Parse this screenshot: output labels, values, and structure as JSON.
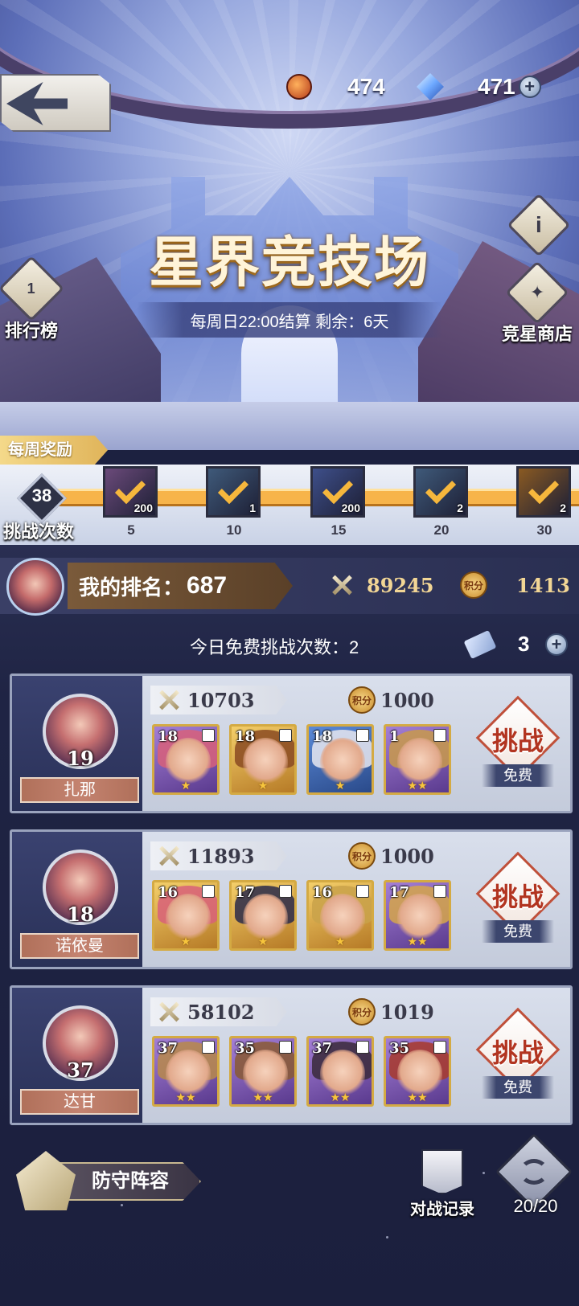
{
  "header": {
    "currency_1": {
      "icon": "scroll-token-icon",
      "value": "474"
    },
    "currency_2": {
      "icon": "blue-crystal-icon",
      "value": "471",
      "plus": "+"
    }
  },
  "arena": {
    "title": "星界竞技场",
    "subtitle": "每周日22:00结算  剩余：6天"
  },
  "side_buttons": {
    "leaderboard": "排行榜",
    "info": "i",
    "shop": "竞星商店"
  },
  "weekly_reward": {
    "tag": "每周奖励",
    "challenge_count": "38",
    "challenge_label": "挑战次数",
    "progress_fraction": 1.0,
    "milestones": [
      {
        "threshold": "5",
        "qty": "200",
        "color": "#6b4a7a"
      },
      {
        "threshold": "10",
        "qty": "1",
        "color": "#3f5a7a"
      },
      {
        "threshold": "15",
        "qty": "200",
        "color": "#3e4f8a"
      },
      {
        "threshold": "20",
        "qty": "2",
        "color": "#3f5a7a"
      },
      {
        "threshold": "30",
        "qty": "2",
        "color": "#8a5a22"
      }
    ]
  },
  "my_rank": {
    "label": "我的排名：",
    "value": "687",
    "power": "89245",
    "score_badge": "积分",
    "score": "1413"
  },
  "free_challenges": {
    "label": "今日免费挑战次数：2",
    "tickets": "3",
    "plus": "+"
  },
  "opponents": [
    {
      "name": "扎那",
      "level": "19",
      "power": "10703",
      "score_badge": "积分",
      "score": "1000",
      "challenge": "挑战",
      "cost": "免费",
      "heroes": [
        {
          "level": "18",
          "frame": "purple",
          "hair": "#d8607a"
        },
        {
          "level": "18",
          "frame": "gold",
          "hair": "#8a4a22"
        },
        {
          "level": "18",
          "frame": "blue",
          "hair": "#e8e8f0"
        },
        {
          "level": "1",
          "frame": "purple",
          "hair": "#c99a4a"
        }
      ]
    },
    {
      "name": "诺依曼",
      "level": "18",
      "power": "11893",
      "score_badge": "积分",
      "score": "1000",
      "challenge": "挑战",
      "cost": "免费",
      "heroes": [
        {
          "level": "16",
          "frame": "gold",
          "hair": "#d8607a"
        },
        {
          "level": "17",
          "frame": "gold",
          "hair": "#2a2a4a"
        },
        {
          "level": "16",
          "frame": "gold",
          "hair": "#c9a24a"
        },
        {
          "level": "17",
          "frame": "purple",
          "hair": "#d6a64a"
        }
      ]
    },
    {
      "name": "达甘",
      "level": "37",
      "power": "58102",
      "score_badge": "积分",
      "score": "1019",
      "challenge": "挑战",
      "cost": "免费",
      "heroes": [
        {
          "level": "37",
          "frame": "purple",
          "hair": "#b88a4a"
        },
        {
          "level": "35",
          "frame": "purple",
          "hair": "#8a5a32"
        },
        {
          "level": "37",
          "frame": "purple",
          "hair": "#3a2a3a"
        },
        {
          "level": "35",
          "frame": "purple",
          "hair": "#a83a2a"
        }
      ]
    }
  ],
  "bottom": {
    "defense": "防守阵容",
    "record": "对战记录",
    "refresh": "20/20"
  }
}
